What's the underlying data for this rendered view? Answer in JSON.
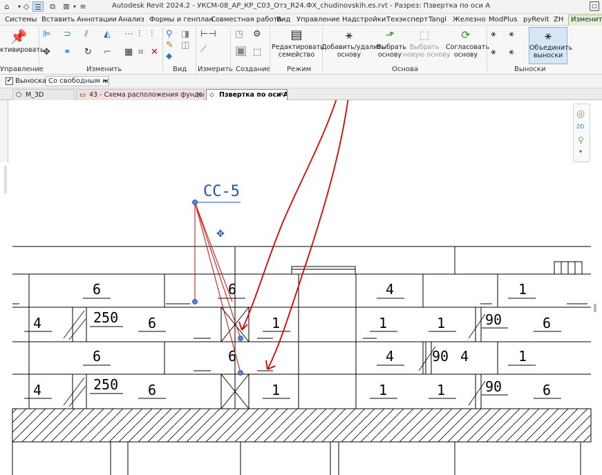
{
  "title_bar": {
    "title": "Autodesk Revit 2024.2 - УКСМ-08_АР_КР_С03_Отз_R24.ФХ_chudinovskih.es.rvt - Разрез: Пзвертка по оси А"
  },
  "ribbon_tabs": [
    "Системы",
    "Вставить",
    "Аннотации",
    "Анализ",
    "Формы и генплан",
    "Совместная работа",
    "Вид",
    "Управление",
    "Надстройки",
    "Техэксперт",
    "Tangl",
    "Железно",
    "ModPlus",
    "pyRevit",
    "ZH",
    "Изменить"
  ],
  "ribbon": {
    "activate_label": "ктивировать",
    "panels": {
      "upravlenie": "Управление",
      "izmenit": "Изменить",
      "vid": "Вид",
      "izmerit": "Измерить",
      "sozdanie": "Создание",
      "rezhim": "Режим",
      "osnova": "Основа",
      "vynoski": "Выноски"
    },
    "buttons": {
      "edit_family": "Редактировать\nсемейство",
      "add_remove_host": "Добавить/удалить\nоснову",
      "pick_host": "Выбрать\nоснову",
      "pick_new_host": "Выбрать\nновую основу",
      "reconcile_host": "Согласовать\nоснову",
      "merge_leaders": "Объединить\nвыноски"
    }
  },
  "options_bar": {
    "leader_checkbox_label": "Выноска",
    "leader_checked": true,
    "leader_type_value": "Со свободным ко"
  },
  "doc_tabs": [
    {
      "label": "M_3D",
      "active": false
    },
    {
      "label": "43 - Схема расположения фундам...",
      "active": false
    },
    {
      "label": "Пзвертка по оси А",
      "active": true
    }
  ],
  "drawing": {
    "tag_label": "СС-5",
    "row1_labels": [
      "6",
      "6",
      "4",
      "1"
    ],
    "row2_labels": [
      "4",
      "250",
      "6",
      "1",
      "1",
      "1",
      "90",
      "6"
    ],
    "row3_labels": [
      "6",
      "6",
      "4",
      "90",
      "4",
      "1"
    ],
    "row4_labels": [
      "4",
      "250",
      "6",
      "1",
      "1",
      "1",
      "90",
      "6"
    ]
  },
  "colors": {
    "ribbon_active_tab": "#e2f0d8",
    "annotation_red": "#e00000",
    "tag_blue": "#1f4fbf",
    "grip_blue": "#5b7fd6"
  }
}
